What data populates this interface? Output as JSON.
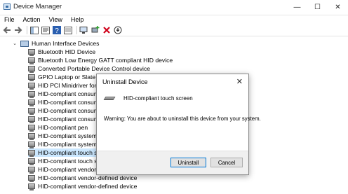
{
  "window": {
    "title": "Device Manager",
    "controls": {
      "minimize": "—",
      "maximize": "☐",
      "close": "✕"
    }
  },
  "menu": [
    "File",
    "Action",
    "View",
    "Help"
  ],
  "toolbar": {
    "icons": [
      "back-arrow-icon",
      "forward-arrow-icon",
      "show-hide-console-tree-icon",
      "properties-icon",
      "help-icon",
      "update-driver-icon",
      "scan-hardware-icon",
      "add-device-icon",
      "uninstall-x-icon",
      "download-icon"
    ]
  },
  "tree": {
    "category": "Human Interface Devices",
    "items": [
      "Bluetooth HID Device",
      "Bluetooth Low Energy GATT compliant HID device",
      "Converted Portable Device Control device",
      "GPIO Laptop or Slate Indicator Driver",
      "HID PCI Minidriver for ISS",
      "HID-compliant consumer control device",
      "HID-compliant consumer control device",
      "HID-compliant consumer control device",
      "HID-compliant consumer control device",
      "HID-compliant pen",
      "HID-compliant system controller",
      "HID-compliant system controller",
      "HID-compliant touch screen",
      "HID-compliant touch screen",
      "HID-compliant vendor-defined device",
      "HID-compliant vendor-defined device",
      "HID-compliant vendor-defined device"
    ],
    "selected_index": 12
  },
  "dialog": {
    "title": "Uninstall Device",
    "close": "✕",
    "device_name": "HID-compliant touch screen",
    "warning": "Warning: You are about to uninstall this device from your system.",
    "buttons": {
      "uninstall": "Uninstall",
      "cancel": "Cancel"
    }
  }
}
